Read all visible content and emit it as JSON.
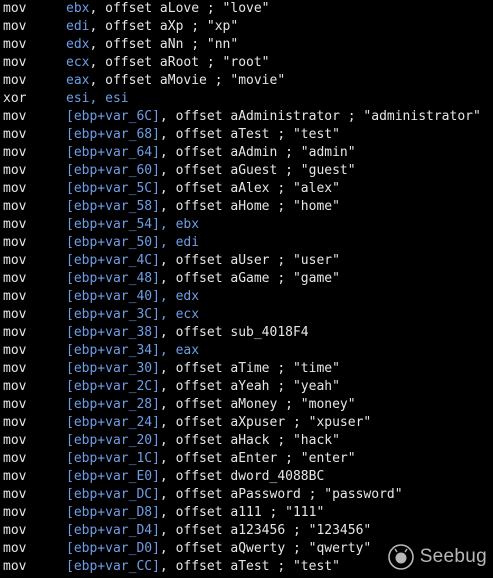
{
  "colors": {
    "background": "#000000",
    "plain_text": "#e6e6e6",
    "register_and_stack_ref": "#6e9ee6"
  },
  "listing": [
    {
      "mnemonic": "mov",
      "reg": "ebx",
      "rest": ", offset aLove ; \"love\""
    },
    {
      "mnemonic": "mov",
      "reg": "edi",
      "rest": ", offset aXp ; \"xp\""
    },
    {
      "mnemonic": "mov",
      "reg": "edx",
      "rest": ", offset aNn ; \"nn\""
    },
    {
      "mnemonic": "mov",
      "reg": "ecx",
      "rest": ", offset aRoot ; \"root\""
    },
    {
      "mnemonic": "mov",
      "reg": "eax",
      "rest": ", offset aMovie ; \"movie\""
    },
    {
      "mnemonic": "xor",
      "reg": "esi, esi",
      "rest": ""
    },
    {
      "mnemonic": "mov",
      "reg": "[ebp+var_6C]",
      "rest": ", offset aAdministrator ; \"administrator\""
    },
    {
      "mnemonic": "mov",
      "reg": "[ebp+var_68]",
      "rest": ", offset aTest ; \"test\""
    },
    {
      "mnemonic": "mov",
      "reg": "[ebp+var_64]",
      "rest": ", offset aAdmin ; \"admin\""
    },
    {
      "mnemonic": "mov",
      "reg": "[ebp+var_60]",
      "rest": ", offset aGuest ; \"guest\""
    },
    {
      "mnemonic": "mov",
      "reg": "[ebp+var_5C]",
      "rest": ", offset aAlex ; \"alex\""
    },
    {
      "mnemonic": "mov",
      "reg": "[ebp+var_58]",
      "rest": ", offset aHome ; \"home\""
    },
    {
      "mnemonic": "mov",
      "reg": "[ebp+var_54], ebx",
      "rest": ""
    },
    {
      "mnemonic": "mov",
      "reg": "[ebp+var_50], edi",
      "rest": ""
    },
    {
      "mnemonic": "mov",
      "reg": "[ebp+var_4C]",
      "rest": ", offset aUser ; \"user\""
    },
    {
      "mnemonic": "mov",
      "reg": "[ebp+var_48]",
      "rest": ", offset aGame ; \"game\""
    },
    {
      "mnemonic": "mov",
      "reg": "[ebp+var_40], edx",
      "rest": ""
    },
    {
      "mnemonic": "mov",
      "reg": "[ebp+var_3C], ecx",
      "rest": ""
    },
    {
      "mnemonic": "mov",
      "reg": "[ebp+var_38]",
      "rest": ", offset sub_4018F4"
    },
    {
      "mnemonic": "mov",
      "reg": "[ebp+var_34], eax",
      "rest": ""
    },
    {
      "mnemonic": "mov",
      "reg": "[ebp+var_30]",
      "rest": ", offset aTime ; \"time\""
    },
    {
      "mnemonic": "mov",
      "reg": "[ebp+var_2C]",
      "rest": ", offset aYeah ; \"yeah\""
    },
    {
      "mnemonic": "mov",
      "reg": "[ebp+var_28]",
      "rest": ", offset aMoney ; \"money\""
    },
    {
      "mnemonic": "mov",
      "reg": "[ebp+var_24]",
      "rest": ", offset aXpuser ; \"xpuser\""
    },
    {
      "mnemonic": "mov",
      "reg": "[ebp+var_20]",
      "rest": ", offset aHack ; \"hack\""
    },
    {
      "mnemonic": "mov",
      "reg": "[ebp+var_1C]",
      "rest": ", offset aEnter ; \"enter\""
    },
    {
      "mnemonic": "mov",
      "reg": "[ebp+var_E0]",
      "rest": ", offset dword_4088BC"
    },
    {
      "mnemonic": "mov",
      "reg": "[ebp+var_DC]",
      "rest": ", offset aPassword ; \"password\""
    },
    {
      "mnemonic": "mov",
      "reg": "[ebp+var_D8]",
      "rest": ", offset a111 ; \"111\""
    },
    {
      "mnemonic": "mov",
      "reg": "[ebp+var_D4]",
      "rest": ", offset a123456 ; \"123456\""
    },
    {
      "mnemonic": "mov",
      "reg": "[ebp+var_D0]",
      "rest": ", offset aQwerty ; \"qwerty\""
    },
    {
      "mnemonic": "mov",
      "reg": "[ebp+var_CC]",
      "rest": ", offset aTest ; \"test\""
    }
  ],
  "watermark": {
    "icon": "seebug-logo-icon",
    "text": "Seebug"
  }
}
